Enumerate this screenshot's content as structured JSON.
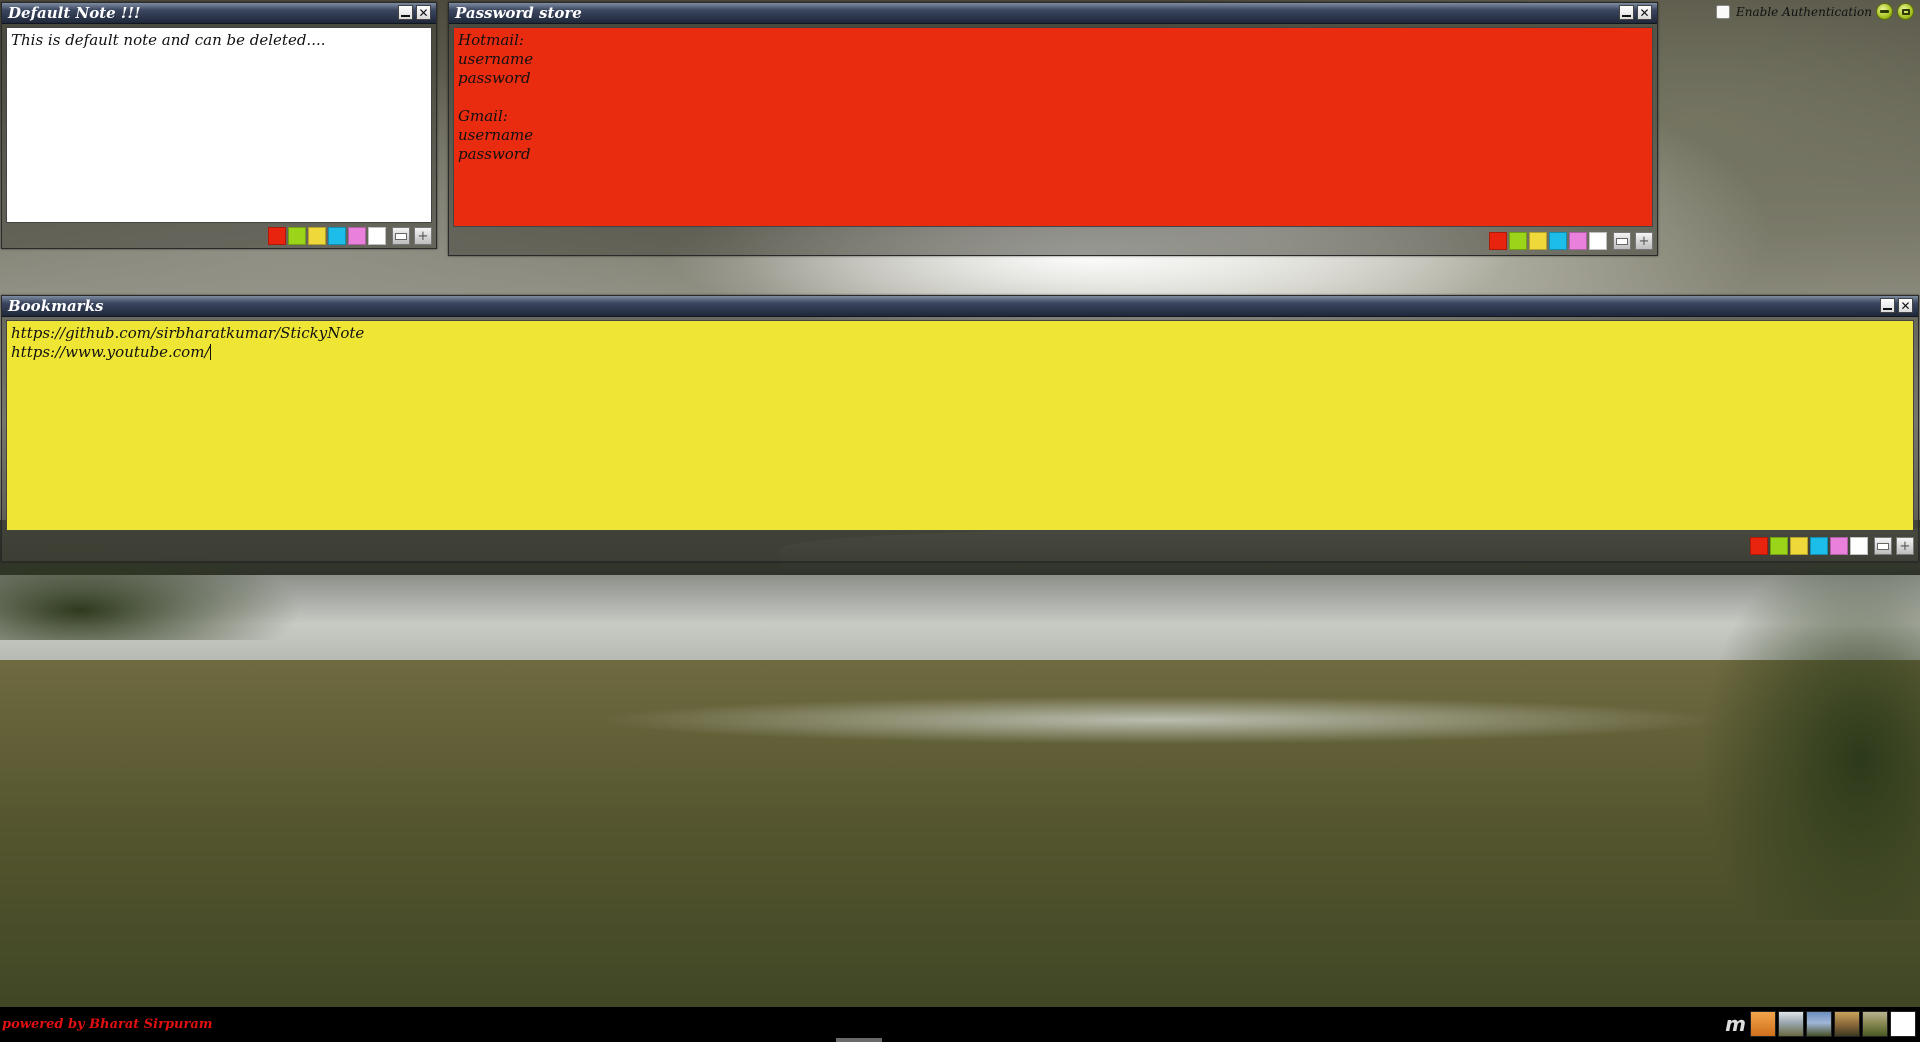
{
  "auth": {
    "label": "Enable Authentication"
  },
  "window_controls": {
    "minimize_icon": "minus-icon",
    "maximize_icon": "restore-icon"
  },
  "palette": [
    "#e8230e",
    "#9ad51a",
    "#eed83a",
    "#1cbde8",
    "#e880dc",
    "#ffffff"
  ],
  "notes": [
    {
      "title": "Default Note !!!",
      "text": "This is default note and can be deleted....",
      "bg": "#ffffff"
    },
    {
      "title": "Password store",
      "text": "Hotmail:\nusername\npassword\n\nGmail:\nusername\npassword",
      "bg": "#e92b10"
    },
    {
      "title": "Bookmarks",
      "text": "https://github.com/sirbharatkumar/StickyNote\nhttps://www.youtube.com/",
      "bg": "#efe535"
    }
  ],
  "footer": {
    "powered_by": "powered by Bharat Sirpuram",
    "thumbnails": [
      "orange-folder",
      "landscape-1",
      "landscape-2",
      "landscape-3",
      "landscape-4",
      "blank-white"
    ]
  }
}
